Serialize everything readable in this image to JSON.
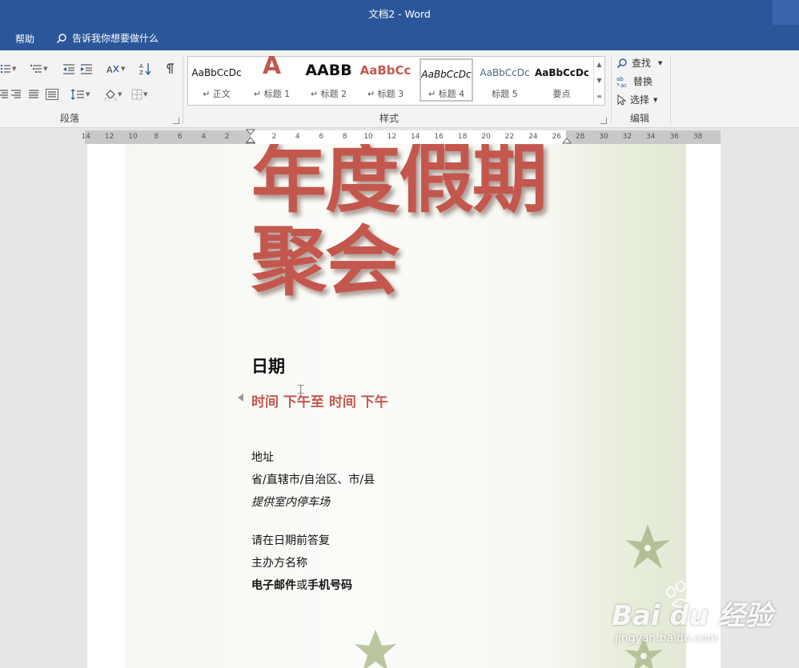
{
  "window": {
    "title": "文档2  -  Word"
  },
  "tabs": {
    "help": "帮助",
    "tell_me": "告诉我你想要做什么"
  },
  "groups": {
    "paragraph": "段落",
    "styles": "样式",
    "editing": "编辑"
  },
  "styles_gallery": [
    {
      "preview": "AaBbCcDc",
      "label": "正文"
    },
    {
      "preview": "A",
      "label": "标题 1"
    },
    {
      "preview": "AABB",
      "label": "标题 2"
    },
    {
      "preview": "AaBbCc",
      "label": "标题 3"
    },
    {
      "preview": "AaBbCcDc",
      "label": "标题 4"
    },
    {
      "preview": "AaBbCcDc",
      "label": "标题 5"
    },
    {
      "preview": "AaBbCcDc",
      "label": "要点"
    }
  ],
  "editing": {
    "find": "查找",
    "replace": "替换",
    "select": "选择"
  },
  "ruler_ticks": [
    "14",
    "12",
    "10",
    "8",
    "6",
    "4",
    "2",
    "2",
    "4",
    "6",
    "8",
    "10",
    "12",
    "14",
    "16",
    "18",
    "20",
    "22",
    "24",
    "26",
    "28",
    "30",
    "32",
    "34",
    "36",
    "38"
  ],
  "document": {
    "title_line1": "年度假期",
    "title_line2": "聚会",
    "date_heading": "日期",
    "time_line": "时间 下午至 时间 下午",
    "address_label": "地址",
    "address_line": "省/直辖市/自治区、市/县",
    "parking": "提供室内停车场",
    "rsvp": "请在日期前答复",
    "organizer": "主办方名称",
    "contact_bold1": "电子邮件",
    "contact_or": "或",
    "contact_bold2": "手机号码"
  },
  "watermark": {
    "brand": "Bai du 经验",
    "url": "jingyan.baidu.com"
  },
  "colors": {
    "titlebar": "#2b579a",
    "accent_red": "#c4574d",
    "leaf_green": "#a9b98a"
  }
}
